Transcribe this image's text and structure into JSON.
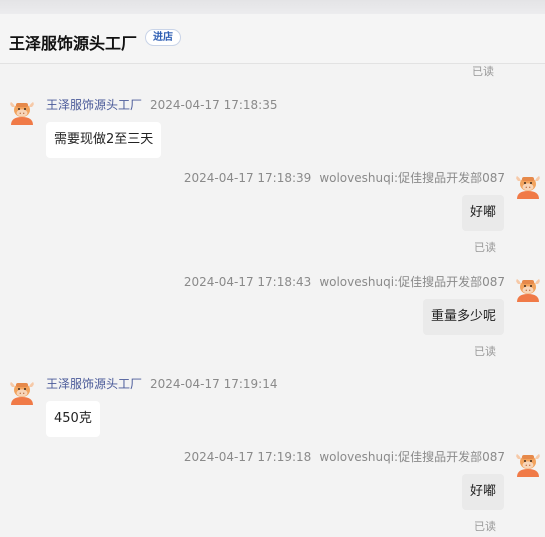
{
  "header": {
    "shop_name": "王泽服饰源头工厂",
    "enter_label": "进店"
  },
  "top_read_label": "已读",
  "messages": [
    {
      "direction": "in",
      "sender": "王泽服饰源头工厂",
      "time": "2024-04-17 17:18:35",
      "text": "需要现做2至三天"
    },
    {
      "direction": "out",
      "sender": "woloveshuqi:促佳搜品开发部087",
      "time": "2024-04-17 17:18:39",
      "text": "好嘟",
      "status": "已读"
    },
    {
      "direction": "out",
      "sender": "woloveshuqi:促佳搜品开发部087",
      "time": "2024-04-17 17:18:43",
      "text": "重量多少呢",
      "status": "已读"
    },
    {
      "direction": "in",
      "sender": "王泽服饰源头工厂",
      "time": "2024-04-17 17:19:14",
      "text": "450克"
    },
    {
      "direction": "out",
      "sender": "woloveshuqi:促佳搜品开发部087",
      "time": "2024-04-17 17:19:18",
      "text": "好嘟",
      "status": "已读"
    }
  ],
  "icons": {
    "avatar": "cartoon-cow-avatar-icon"
  },
  "colors": {
    "background": "#f3f3f3",
    "bubble_in": "#ffffff",
    "bubble_out": "#eaeaea",
    "sender_link": "#4a5a99"
  }
}
